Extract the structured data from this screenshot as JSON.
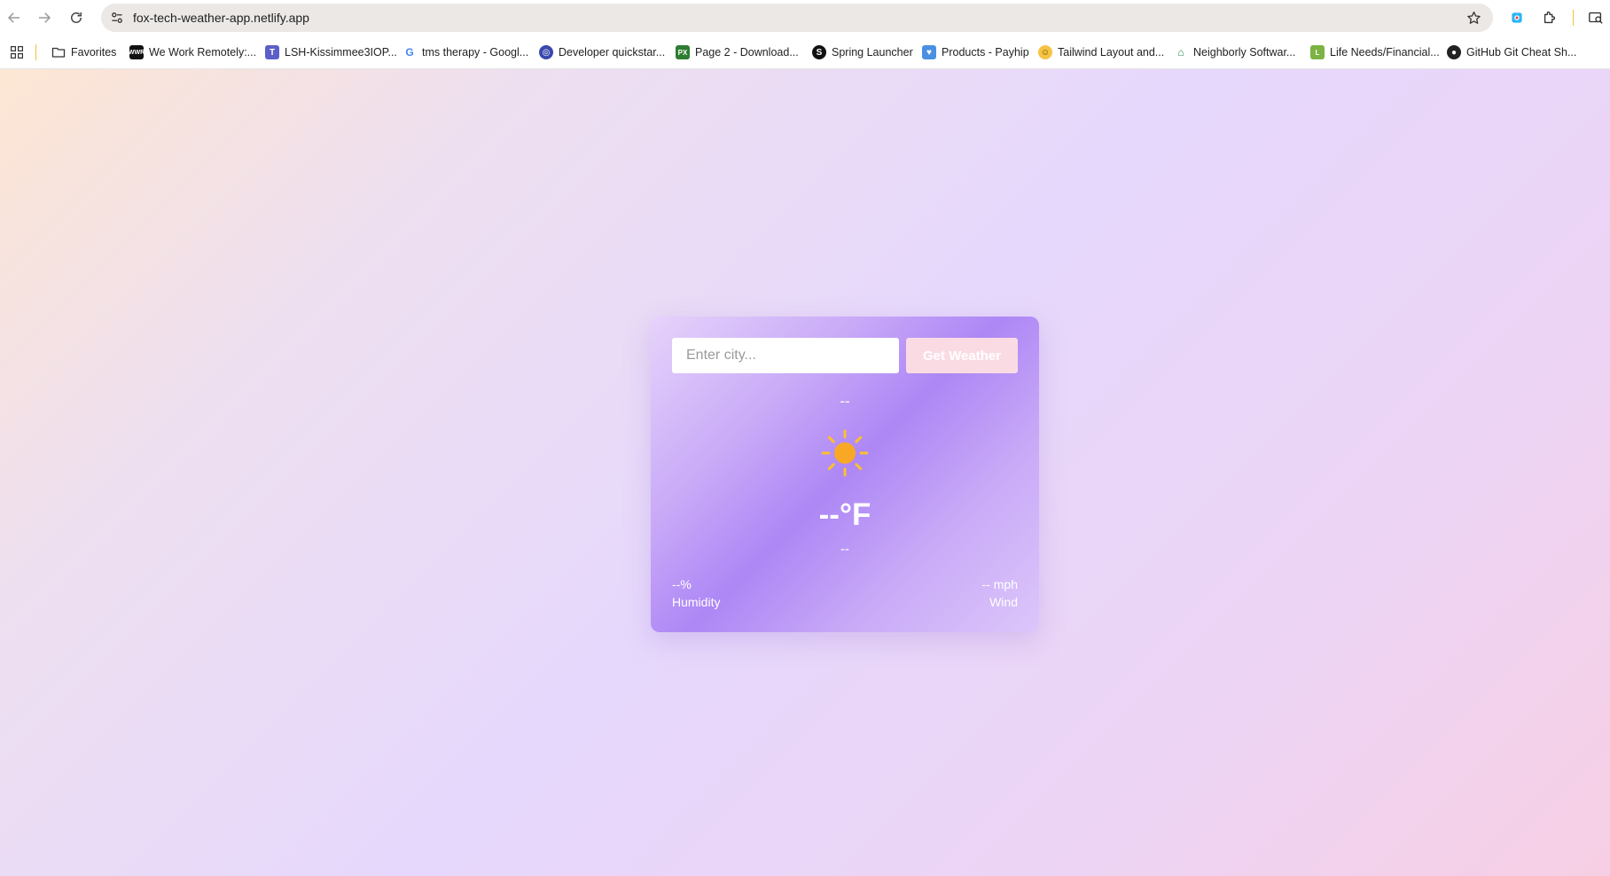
{
  "browser": {
    "url": "fox-tech-weather-app.netlify.app",
    "bookmarks": [
      {
        "label": "Favorites",
        "icon": "folder-icon"
      },
      {
        "label": "We Work Remotely:...",
        "icon": "wwr-favicon"
      },
      {
        "label": "LSH-Kissimmee3IOP...",
        "icon": "teams-favicon"
      },
      {
        "label": "tms therapy - Googl...",
        "icon": "google-favicon"
      },
      {
        "label": "Developer quickstar...",
        "icon": "developer-favicon"
      },
      {
        "label": "Page 2 - Download...",
        "icon": "px-favicon"
      },
      {
        "label": "Spring Launcher",
        "icon": "spring-favicon"
      },
      {
        "label": "Products - Payhip",
        "icon": "payhip-favicon"
      },
      {
        "label": "Tailwind Layout and...",
        "icon": "tailwind-favicon"
      },
      {
        "label": "Neighborly Softwar...",
        "icon": "neighborly-favicon"
      },
      {
        "label": "Life Needs/Financial...",
        "icon": "life-needs-favicon"
      },
      {
        "label": "GitHub Git Cheat Sh...",
        "icon": "github-favicon"
      }
    ]
  },
  "weather": {
    "search_placeholder": "Enter city...",
    "button_label": "Get Weather",
    "city": "--",
    "icon": "sun-icon",
    "temperature": "--°F",
    "description": "--",
    "humidity_value": "--%",
    "humidity_label": "Humidity",
    "wind_value": "-- mph",
    "wind_label": "Wind"
  },
  "colors": {
    "card_accent": "#ad87f5",
    "button_bg": "#fadbe4",
    "sun": "#f9a825"
  }
}
